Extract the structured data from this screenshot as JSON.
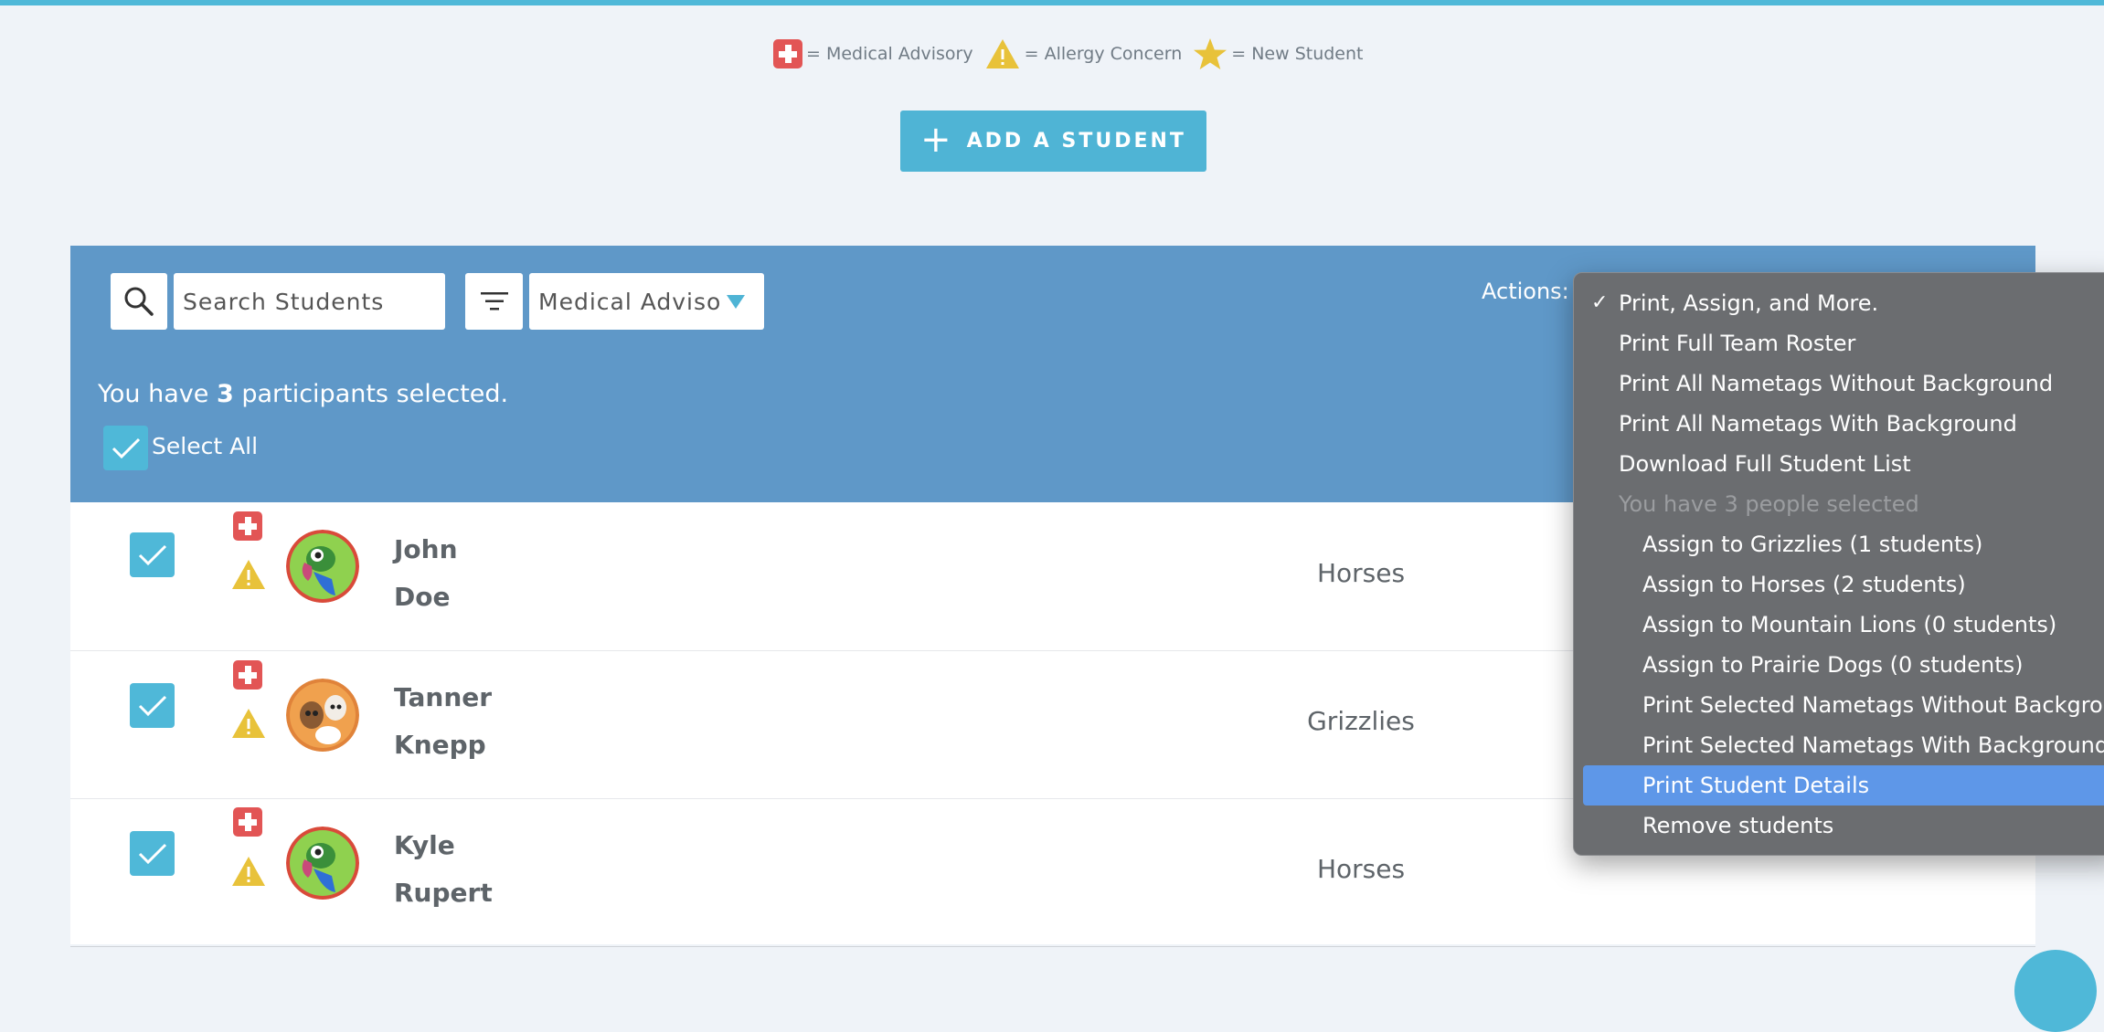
{
  "legend": {
    "medical_label": "= Medical Advisory",
    "allergy_label": "= Allergy Concern",
    "new_label": "= New Student"
  },
  "add_button": {
    "label": "ADD A STUDENT"
  },
  "toolbar": {
    "search_placeholder": "Search Students",
    "filter_value": "Medical Adviso",
    "actions_label": "Actions:"
  },
  "selection": {
    "prefix": "You have ",
    "count": "3",
    "suffix": " participants selected.",
    "select_all_label": "Select All"
  },
  "students": [
    {
      "first": "John",
      "last": "Doe",
      "team": "Horses"
    },
    {
      "first": "Tanner",
      "last": "Knepp",
      "team": "Grizzlies"
    },
    {
      "first": "Kyle",
      "last": "Rupert",
      "team": "Horses"
    }
  ],
  "actions_menu": {
    "items": [
      {
        "label": "Print, Assign, and More.",
        "checked": true
      },
      {
        "label": "Print Full Team Roster"
      },
      {
        "label": "Print All Nametags Without Background"
      },
      {
        "label": "Print All Nametags With Background"
      },
      {
        "label": "Download Full Student List"
      },
      {
        "label": "You have 3 people selected",
        "disabled": true
      },
      {
        "label": "Assign to Grizzlies (1 students)"
      },
      {
        "label": "Assign to Horses (2 students)"
      },
      {
        "label": "Assign to Mountain Lions (0 students)"
      },
      {
        "label": "Assign to Prairie Dogs (0 students)"
      },
      {
        "label": "Print Selected Nametags Without Background"
      },
      {
        "label": "Print Selected Nametags With Background"
      },
      {
        "label": "Print Student Details",
        "highlighted": true
      },
      {
        "label": "Remove students"
      }
    ],
    "check_mark": "✓"
  },
  "colors": {
    "accent": "#4fb8d8",
    "panel": "#5f98c8",
    "medical": "#e25555",
    "allergy": "#e8c23a",
    "menu_highlight": "#5e97e8"
  }
}
